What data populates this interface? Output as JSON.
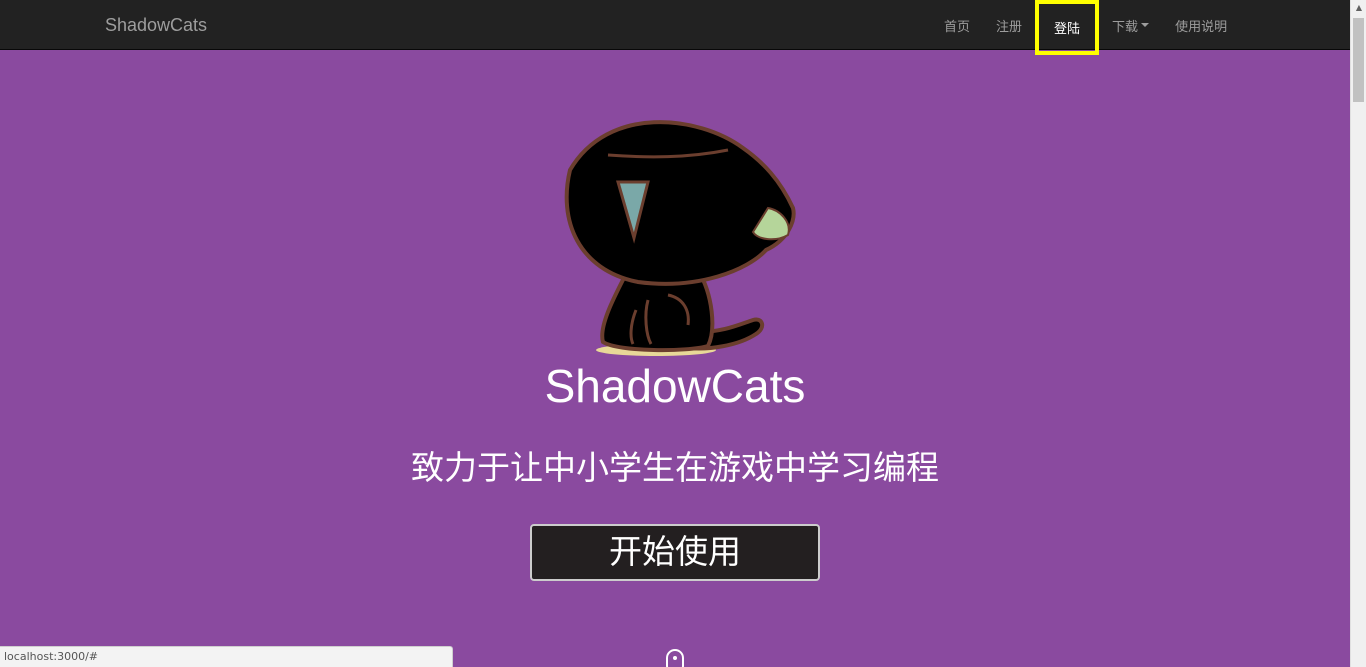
{
  "navbar": {
    "brand": "ShadowCats",
    "items": [
      {
        "label": "首页"
      },
      {
        "label": "注册"
      },
      {
        "label": "登陆"
      },
      {
        "label": "下载"
      },
      {
        "label": "使用说明"
      }
    ]
  },
  "hero": {
    "title": "ShadowCats",
    "subtitle": "致力于让中小学生在游戏中学习编程",
    "start_button": "开始使用"
  },
  "status_bar": {
    "url": "localhost:3000/#"
  },
  "colors": {
    "background": "#8a4a9f",
    "navbar": "#222222",
    "highlight": "#ffff00",
    "button": "#231f20"
  }
}
